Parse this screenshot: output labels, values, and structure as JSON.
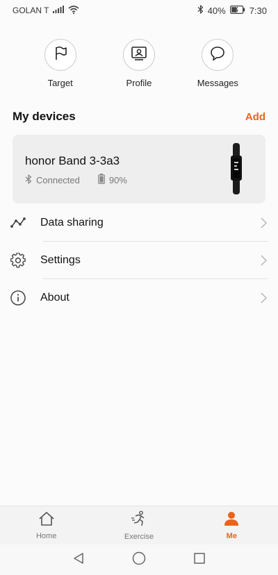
{
  "status_bar": {
    "carrier": "GOLAN T",
    "battery": "40%",
    "time": "7:30"
  },
  "shortcuts": [
    {
      "label": "Target",
      "icon": "flag-icon"
    },
    {
      "label": "Profile",
      "icon": "profile-card-icon"
    },
    {
      "label": "Messages",
      "icon": "chat-bubble-icon"
    }
  ],
  "devices": {
    "title": "My devices",
    "add_label": "Add",
    "device": {
      "name": "honor Band 3-3a3",
      "status": "Connected",
      "battery": "90%"
    }
  },
  "menu": [
    {
      "label": "Data sharing",
      "icon": "data-sharing-icon"
    },
    {
      "label": "Settings",
      "icon": "gear-icon"
    },
    {
      "label": "About",
      "icon": "info-icon"
    }
  ],
  "tabs": [
    {
      "label": "Home",
      "icon": "home-icon",
      "active": false
    },
    {
      "label": "Exercise",
      "icon": "running-icon",
      "active": false
    },
    {
      "label": "Me",
      "icon": "person-icon",
      "active": true
    }
  ],
  "colors": {
    "accent": "#e8641e",
    "card_bg": "#eeeeee",
    "background": "#fbfbfb"
  }
}
